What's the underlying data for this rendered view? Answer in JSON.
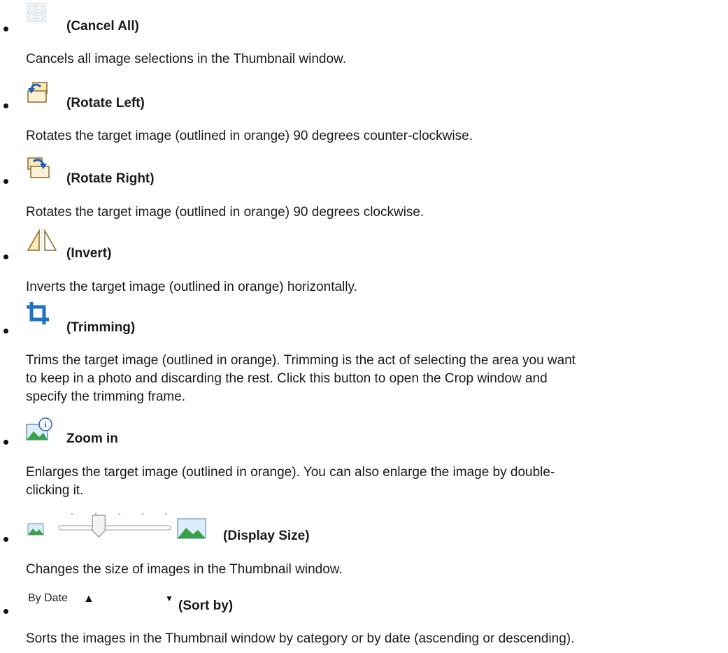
{
  "items": [
    {
      "icon": "select-cancel-icon",
      "title": "(Cancel All)",
      "desc": "Cancels all image selections in the Thumbnail window."
    },
    {
      "icon": "rotate-left-icon",
      "title": "(Rotate Left)",
      "desc": "Rotates the target image (outlined in orange) 90 degrees counter-clockwise."
    },
    {
      "icon": "rotate-right-icon",
      "title": "(Rotate Right)",
      "desc": "Rotates the target image (outlined in orange) 90 degrees clockwise."
    },
    {
      "icon": "invert-icon",
      "title": "(Invert)",
      "desc": "Inverts the target image (outlined in orange) horizontally."
    },
    {
      "icon": "crop-icon",
      "title": "(Trimming)",
      "desc_lines": [
        "Trims the target image (outlined in orange). Trimming is the act of selecting the area you want",
        "to keep in a photo and discarding the rest. Click this button to open the Crop window and",
        "specify the trimming frame."
      ]
    },
    {
      "icon": "zoom-in-image-icon",
      "title": "Zoom in",
      "desc_lines": [
        "Enlarges the target image (outlined in orange). You can also enlarge the image by double-",
        "clicking it."
      ]
    },
    {
      "icon": "display-size-slider",
      "title": "(Display Size)",
      "desc": "Changes the size of images in the Thumbnail window.",
      "slider_value": 0.35
    },
    {
      "icon": "sort-dropdown",
      "title": "(Sort by)",
      "dropdown_value": "By Date",
      "desc": "Sorts the images in the Thumbnail window by category or by date (ascending or descending)."
    }
  ]
}
